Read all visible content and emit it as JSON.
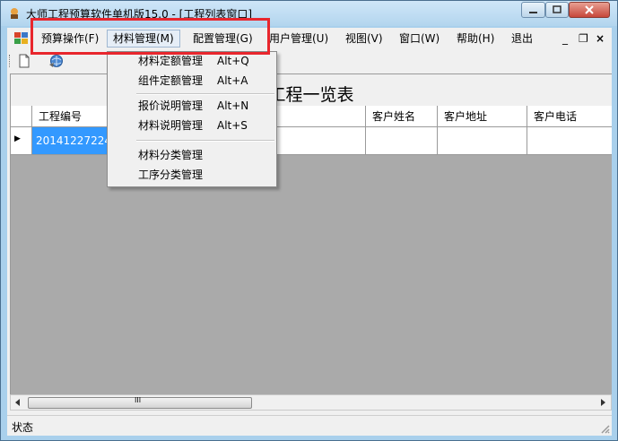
{
  "window": {
    "title": "大师工程预算软件单机版15.0 - [工程列表窗口]"
  },
  "menubar": {
    "items": [
      {
        "label": "预算操作(F)"
      },
      {
        "label": "材料管理(M)"
      },
      {
        "label": "配置管理(G)"
      },
      {
        "label": "用户管理(U)"
      },
      {
        "label": "视图(V)"
      },
      {
        "label": "窗口(W)"
      },
      {
        "label": "帮助(H)"
      },
      {
        "label": "退出"
      }
    ],
    "mdi_minimize": "_",
    "mdi_restore": "❐",
    "mdi_close": "×"
  },
  "dropdown": {
    "items": [
      {
        "label": "材料定额管理",
        "shortcut": "Alt+Q"
      },
      {
        "label": "组件定额管理",
        "shortcut": "Alt+A"
      },
      {
        "label": "报价说明管理",
        "shortcut": "Alt+N"
      },
      {
        "label": "材料说明管理",
        "shortcut": "Alt+S"
      },
      {
        "label": "材料分类管理",
        "shortcut": ""
      },
      {
        "label": "工序分类管理",
        "shortcut": ""
      }
    ]
  },
  "grid": {
    "caption": "工程一览表",
    "columns": [
      "工程编号",
      "",
      "客户姓名",
      "客户地址",
      "客户电话"
    ],
    "rows": [
      {
        "工程编号": "20141227224",
        "客户姓名": "",
        "客户地址": "",
        "客户电话": ""
      }
    ],
    "row_indicator": "▶",
    "scroll_grip": "III"
  },
  "statusbar": {
    "text": "状态"
  },
  "colors": {
    "highlight_box": "#e8262d",
    "selected_cell": "#3399ff",
    "grid_bg": "#aaaaaa"
  },
  "icons": [
    "app-icon",
    "mdi-child-icon",
    "new-document-icon",
    "refresh-globe-icon",
    "minimize-icon",
    "maximize-icon",
    "close-icon",
    "row-indicator-icon",
    "size-grip-icon"
  ]
}
